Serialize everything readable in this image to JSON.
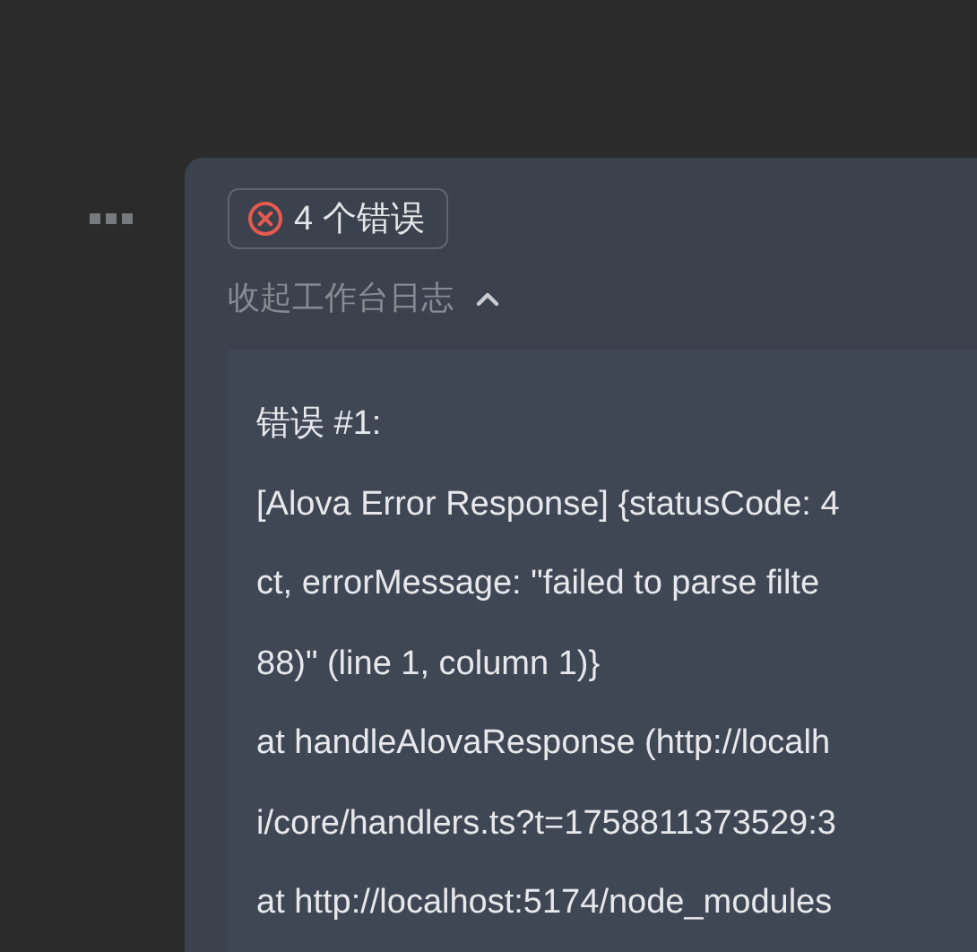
{
  "error_badge": {
    "label": "4 个错误"
  },
  "log_toggle": {
    "label": "收起工作台日志",
    "expanded": true
  },
  "log": {
    "lines": [
      "错误 #1:",
      "[Alova Error Response] {statusCode: 4",
      "ct, errorMessage: \"failed to parse filte",
      "88)\" (line 1, column 1)}",
      "at handleAlovaResponse (http://localh",
      "i/core/handlers.ts?t=1758811373529:3",
      "at http://localhost:5174/node_modules"
    ]
  }
}
